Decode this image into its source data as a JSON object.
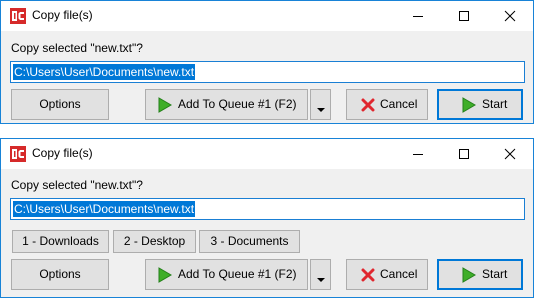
{
  "windows": [
    {
      "title": "Copy file(s)",
      "prompt": "Copy selected \"new.txt\"?",
      "path_value": "C:\\Users\\User\\Documents\\new.txt",
      "buttons": {
        "options": "Options",
        "queue": "Add To Queue #1 (F2)",
        "cancel": "Cancel",
        "start": "Start"
      }
    },
    {
      "title": "Copy file(s)",
      "prompt": "Copy selected \"new.txt\"?",
      "path_value": "C:\\Users\\User\\Documents\\new.txt",
      "favorites": [
        "1 - Downloads",
        "2 - Desktop",
        "3 - Documents"
      ],
      "buttons": {
        "options": "Options",
        "queue": "Add To Queue #1 (F2)",
        "cancel": "Cancel",
        "start": "Start"
      }
    }
  ],
  "icons": {
    "app": "teracopy-app-icon",
    "minimize": "minimize-icon",
    "maximize": "maximize-icon",
    "close": "close-icon",
    "play": "play-icon",
    "cancel": "red-x-icon",
    "dropdown": "chevron-down-icon"
  },
  "colors": {
    "window_border": "#1883d7",
    "selection": "#0078d7",
    "play_green": "#3fae29",
    "cancel_red": "#e0262e",
    "app_icon_red": "#d62a2a"
  }
}
